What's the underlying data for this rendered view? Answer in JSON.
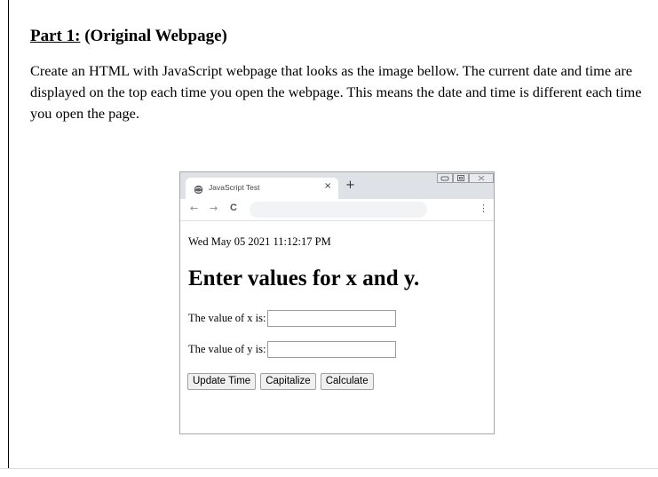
{
  "document": {
    "heading_underlined": "Part 1:",
    "heading_rest": " (Original Webpage)",
    "paragraph": "Create an HTML with JavaScript webpage that looks as the image bellow. The current date and time are displayed on the top each time you open the webpage. This means the date and time is different each time you open the page."
  },
  "browser": {
    "tab_title": "JavaScript Test",
    "tab_close": "×",
    "new_tab": "+",
    "back": "←",
    "forward": "→",
    "reload": "C",
    "menu": "⋮",
    "icons": [
      "globe-icon",
      "minimize-icon",
      "maximize-icon",
      "close-icon"
    ]
  },
  "page": {
    "datetime": "Wed May 05 2021 11:12:17 PM",
    "title": "Enter values for x and y.",
    "x_label": "The value of x is:",
    "y_label": "The value of y is:",
    "x_value": "",
    "y_value": "",
    "buttons": {
      "update": "Update Time",
      "capitalize": "Capitalize",
      "calculate": "Calculate"
    }
  }
}
